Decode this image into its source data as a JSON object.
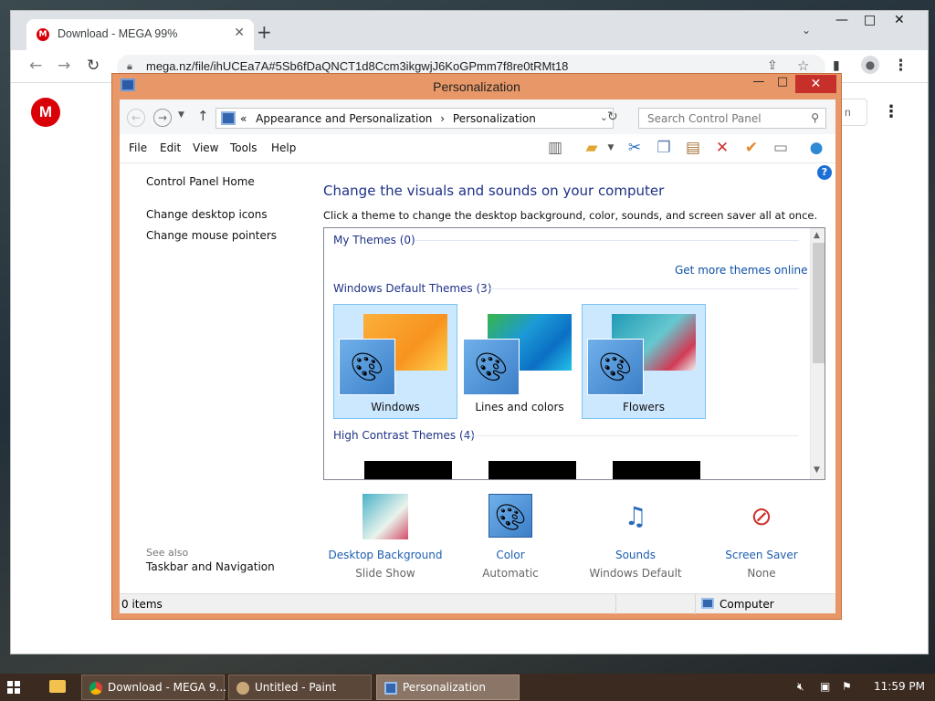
{
  "browser": {
    "tab_title": "Download - MEGA 99%",
    "tab_favicon": "M",
    "new_tab_icon": "+",
    "url": "mega.nz/file/ihUCEa7A#5Sb6fDaQNCT1d8Ccm3ikgwjJ6KoGPmm7f8re0tRMt18",
    "mega_logo": "M",
    "partial_button_text": "n"
  },
  "personalization": {
    "title": "Personalization",
    "breadcrumb_prefix": "«",
    "breadcrumb_1": "Appearance and Personalization",
    "breadcrumb_sep": "›",
    "breadcrumb_2": "Personalization",
    "search_placeholder": "Search Control Panel",
    "menu": [
      "File",
      "Edit",
      "View",
      "Tools",
      "Help"
    ],
    "sidebar": {
      "home": "Control Panel Home",
      "desktop_icons": "Change desktop icons",
      "mouse_pointers": "Change mouse pointers",
      "see_also": "See also",
      "taskbar_nav": "Taskbar and Navigation"
    },
    "heading": "Change the visuals and sounds on your computer",
    "subheading": "Click a theme to change the desktop background, color, sounds, and screen saver all at once.",
    "groups": {
      "my_themes": "My Themes (0)",
      "get_more": "Get more themes online",
      "default_themes": "Windows Default Themes (3)",
      "high_contrast": "High Contrast Themes (4)"
    },
    "themes": [
      {
        "name": "Windows",
        "selected": true
      },
      {
        "name": "Lines and colors",
        "selected": false
      },
      {
        "name": "Flowers",
        "selected": true
      }
    ],
    "options": [
      {
        "label": "Desktop Background",
        "value": "Slide Show"
      },
      {
        "label": "Color",
        "value": "Automatic"
      },
      {
        "label": "Sounds",
        "value": "Windows Default"
      },
      {
        "label": "Screen Saver",
        "value": "None"
      }
    ],
    "status_items": "0 items",
    "status_location": "Computer"
  },
  "taskbar": {
    "tasks": [
      {
        "label": "Download - MEGA 9...",
        "active": false,
        "icon": "chrome-icon"
      },
      {
        "label": "Untitled - Paint",
        "active": false,
        "icon": "paint-icon"
      },
      {
        "label": "Personalization",
        "active": true,
        "icon": "control-panel-icon"
      }
    ],
    "clock": "11:59 PM"
  },
  "colors": {
    "window_frame": "#e89868",
    "link_blue": "#1e3287",
    "selection": "#cce8ff",
    "mega_red": "#d90007",
    "close_red": "#c7302a"
  }
}
